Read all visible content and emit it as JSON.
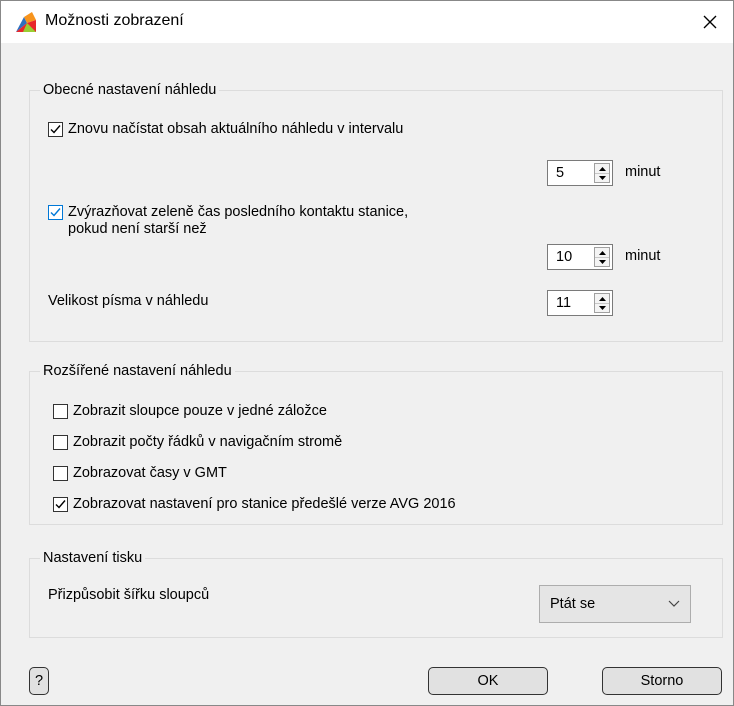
{
  "window": {
    "title": "Možnosti zobrazení",
    "app_icon": "avg-logo-icon",
    "close_icon": "close-icon"
  },
  "general": {
    "legend": "Obecné nastavení náhledu",
    "reload": {
      "label": "Znovu načístat obsah aktuálního náhledu v intervalu",
      "checked": true,
      "value": "5",
      "unit": "minut"
    },
    "highlight": {
      "label_line1": "Zvýrazňovat zeleně čas posledního kontaktu stanice,",
      "label_line2": "pokud není starší než",
      "checked": true,
      "value": "10",
      "unit": "minut"
    },
    "font_size": {
      "label": "Velikost písma v náhledu",
      "value": "11"
    }
  },
  "advanced": {
    "legend": "Rozšířené nastavení náhledu",
    "items": [
      {
        "label": "Zobrazit sloupce pouze v jedné záložce",
        "checked": false
      },
      {
        "label": "Zobrazit počty řádků v navigačním stromě",
        "checked": false
      },
      {
        "label": "Zobrazovat časy v GMT",
        "checked": false
      },
      {
        "label": "Zobrazovat nastavení pro stanice předešlé verze AVG 2016",
        "checked": true
      }
    ]
  },
  "print": {
    "legend": "Nastavení tisku",
    "fit_label": "Přizpůsobit šířku sloupců",
    "fit_value": "Ptát se"
  },
  "buttons": {
    "help": "?",
    "ok": "OK",
    "cancel": "Storno"
  }
}
